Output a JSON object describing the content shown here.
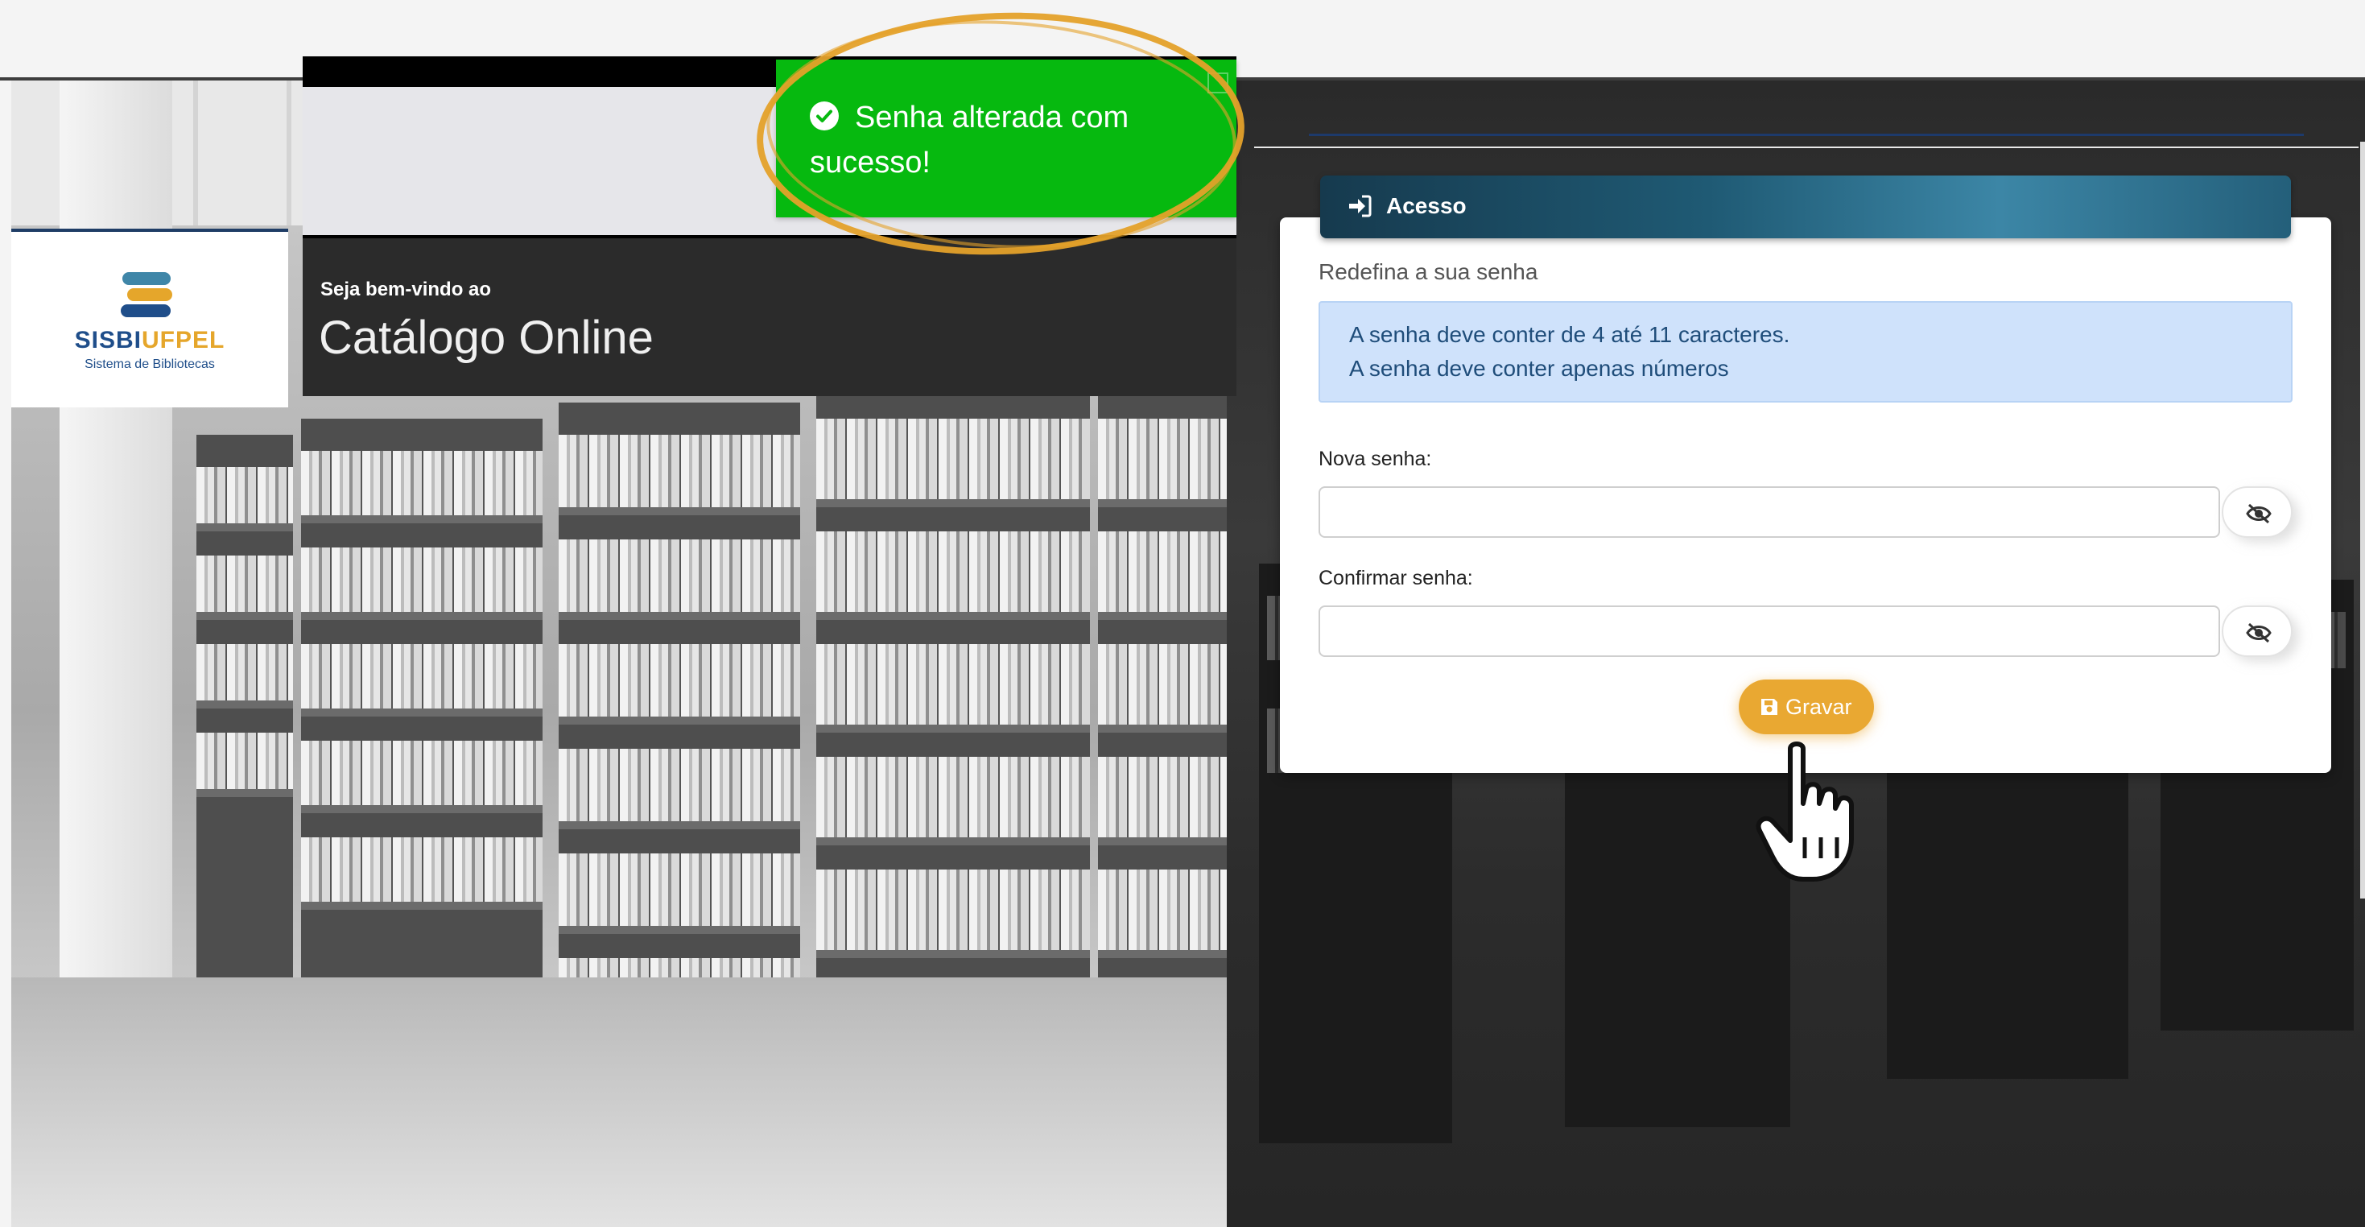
{
  "toast": {
    "message": "Senha alterada com sucesso!",
    "icon": "check-circle-icon",
    "color": "#06b90f"
  },
  "header": {
    "welcome": "Seja bem-vindo ao",
    "title": "Catálogo Online"
  },
  "logo": {
    "name_part1": "SISBI",
    "name_part2": "UFPEL",
    "subtitle": "Sistema de Bibliotecas"
  },
  "card": {
    "header_icon": "sign-in-icon",
    "header_title": "Acesso",
    "subtitle": "Redefina a sua senha",
    "info": [
      "A senha deve conter de 4 até 11 caracteres.",
      "A senha deve conter apenas números"
    ],
    "new_password": {
      "label": "Nova senha:",
      "value": "",
      "toggle_icon": "eye-slash-icon"
    },
    "confirm_password": {
      "label": "Confirmar senha:",
      "value": "",
      "toggle_icon": "eye-slash-icon"
    },
    "save_button": {
      "label": "Gravar",
      "icon": "save-icon",
      "color": "#e9a832"
    }
  },
  "colors": {
    "brand_blue": "#1f4e8a",
    "brand_gold": "#e5a62b",
    "highlight": "#e4a12a"
  }
}
